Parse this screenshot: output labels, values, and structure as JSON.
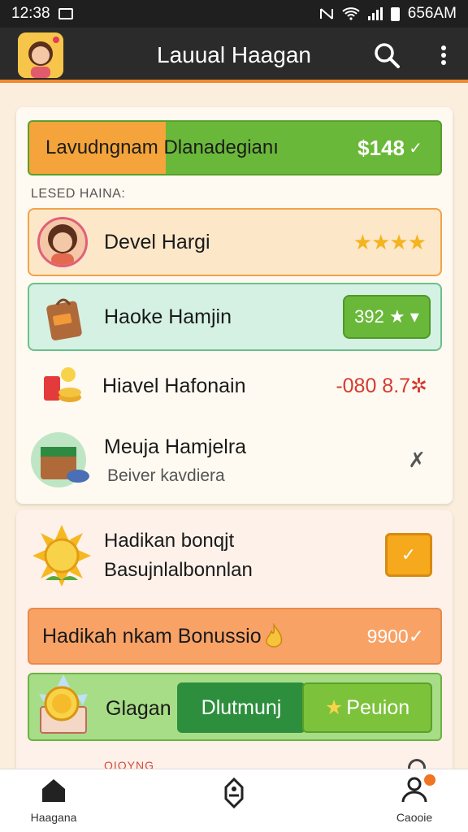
{
  "status_bar": {
    "time": "12:38",
    "clock_right": "656AM"
  },
  "app_bar": {
    "title": "Lauual Haagan"
  },
  "banner": {
    "text": "Lavudngnam Dlanadegianı",
    "amount": "$148",
    "chevron": "✓"
  },
  "section_label": "LESED HAINA:",
  "rows": [
    {
      "name": "Devel Hargi",
      "trail": "★★★★"
    },
    {
      "name": "Haoke Hamjin",
      "trail": "392 ★ ▾"
    },
    {
      "name": "Hiavel Hafonain",
      "trail": "-080 8.7✲"
    },
    {
      "name": "Meuja Hamjelra",
      "sub": "Beiver kavdiera",
      "trail": "✗"
    }
  ],
  "promo": {
    "line1": "Hadikan bonqjt",
    "line2": "Basujnlalbonnlan",
    "check": "✓"
  },
  "bonus": {
    "text": "Hadikah nkam Bonussio",
    "value": "9900✓"
  },
  "action_row": {
    "label": "Glagan",
    "primary": "Dlutmunj",
    "secondary": "Peuion"
  },
  "peek_text": "OIOYNG",
  "bottom_nav": [
    {
      "label": "Haagana"
    },
    {
      "label": ""
    },
    {
      "label": "Caooie"
    }
  ],
  "colors": {
    "accent": "#f08a2c",
    "green": "#6ab839",
    "red": "#d43b32"
  }
}
